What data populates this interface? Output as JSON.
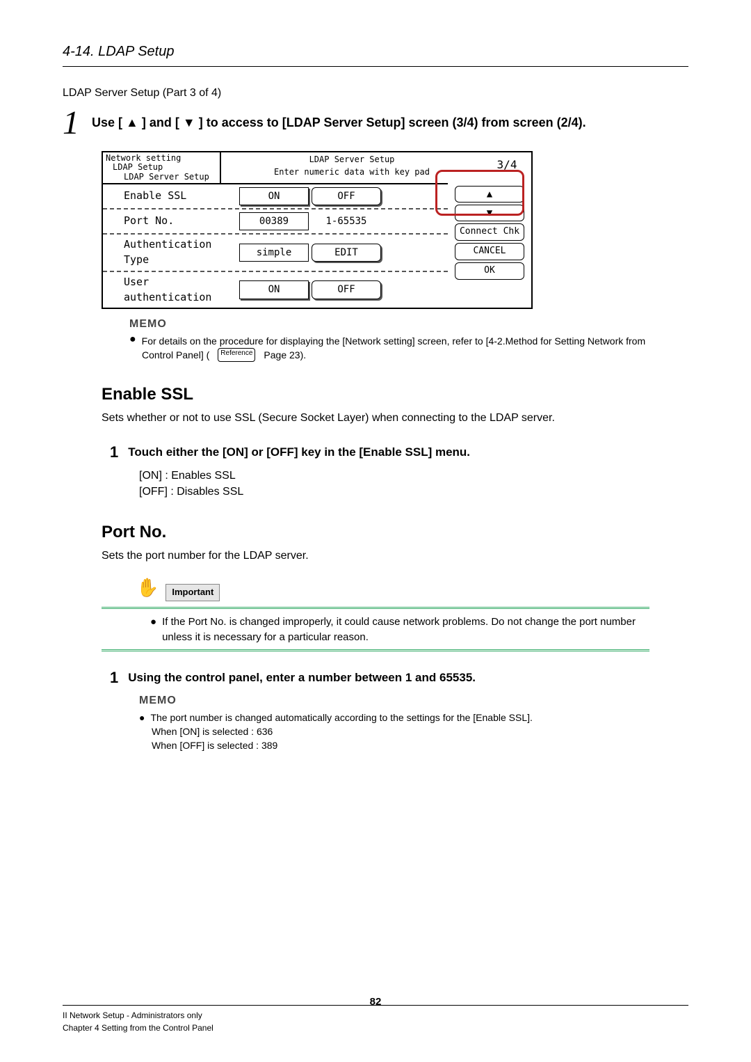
{
  "section_header": "4-14. LDAP Setup",
  "intro_line": "LDAP Server Setup (Part 3 of 4)",
  "step1": {
    "num": "1",
    "pre": "Use [",
    "mid": "] and [",
    "post": "] to access to [LDAP Server Setup] screen (3/4) from screen (2/4)."
  },
  "screenshot": {
    "crumb1": "Network setting",
    "crumb2": "LDAP Setup",
    "crumb3": "LDAP Server Setup",
    "title": "LDAP Server Setup",
    "subtitle": "Enter numeric data with key pad",
    "page": "3/4",
    "rows": [
      {
        "label": "Enable SSL",
        "val1": "ON",
        "val2": "OFF"
      },
      {
        "label": "Port No.",
        "val1": "00389",
        "val2": "1-65535"
      },
      {
        "label": "Authentication Type",
        "val1": "simple",
        "val2": "EDIT"
      },
      {
        "label": "User authentication",
        "val1": "ON",
        "val2": "OFF"
      }
    ],
    "side": {
      "up": "▲",
      "down": "▼",
      "connect": "Connect Chk",
      "cancel": "CANCEL",
      "ok": "OK"
    }
  },
  "memo_label": "MEMO",
  "memo1": {
    "line1_a": "For details on the procedure for displaying the [Network setting] screen, refer to [4-2.Method for Setting Network from",
    "line2_a": "Control Panel] (",
    "ref": "Reference",
    "line2_b": "        Page 23)."
  },
  "enable_ssl": {
    "heading": "Enable SSL",
    "desc": "Sets whether or not to use SSL (Secure Socket Layer) when connecting to the LDAP server.",
    "step_num": "1",
    "step_text": "Touch either the [ON] or [OFF] key in the [Enable SSL] menu.",
    "on": "[ON]   : Enables SSL",
    "off": "[OFF] : Disables SSL"
  },
  "port_no": {
    "heading": "Port No.",
    "desc": "Sets the port number for the LDAP server.",
    "important_label": "Important",
    "imp_text": "If the Port No. is changed improperly, it could cause network problems. Do not change the port number unless it is necessary for a particular reason.",
    "step_num": "1",
    "step_text": "Using the control panel, enter a number between 1 and 65535.",
    "memo_line": "The port number is changed automatically according to the settings for the [Enable SSL].",
    "when_on": "When [ON] is selected : 636",
    "when_off": "When [OFF] is selected : 389"
  },
  "footer": {
    "l1": "II Network Setup - Administrators only",
    "l2": "Chapter 4 Setting from the Control Panel",
    "page": "82"
  }
}
